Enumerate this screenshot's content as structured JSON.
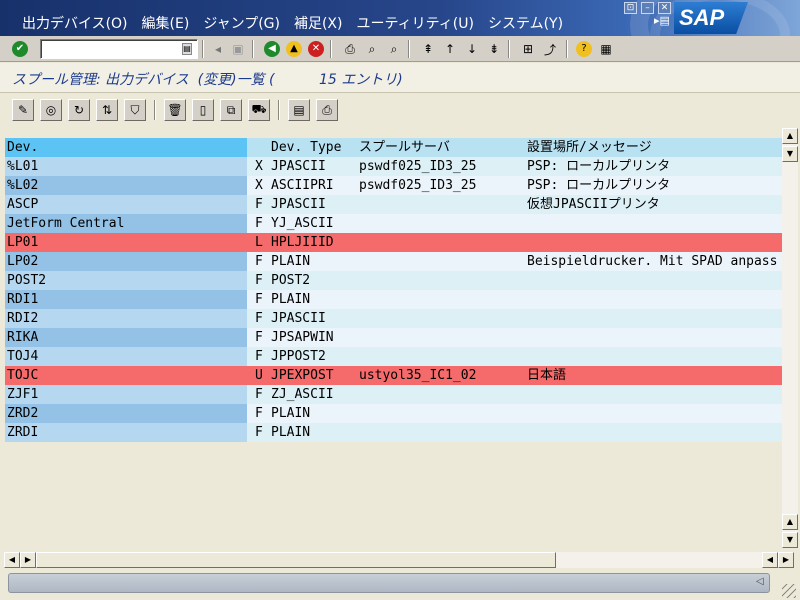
{
  "menubar": {
    "items": [
      {
        "label": "出力デバイス(O)"
      },
      {
        "label": "編集(E)"
      },
      {
        "label": "ジャンプ(G)"
      },
      {
        "label": "補足(X)"
      },
      {
        "label": "ユーティリティ(U)"
      },
      {
        "label": "システム(Y)"
      }
    ],
    "logo": "SAP"
  },
  "toolbar": {
    "command_value": "",
    "icons": [
      "enter-icon",
      "command-field",
      "back-history-icon",
      "save-icon",
      "back-icon",
      "exit-icon",
      "cancel-icon",
      "print-icon",
      "find-icon",
      "find-next-icon",
      "first-page-icon",
      "previous-page-icon",
      "next-page-icon",
      "last-page-icon",
      "new-session-icon",
      "shortcut-icon",
      "help-icon",
      "layout-menu-icon"
    ]
  },
  "title": {
    "text": "スプール管理: 出力デバイス  (変更)一覧 (          15 エントリ)"
  },
  "app_toolbar": {
    "icons": [
      "display-change-icon",
      "detail-icon",
      "refresh-icon",
      "sort-icon",
      "filter-icon",
      "delete-icon",
      "create-icon",
      "copy-icon",
      "transport-icon",
      "spool-request-icon",
      "print-list-icon"
    ]
  },
  "list": {
    "columns": {
      "dev": "Dev.",
      "access": "",
      "type": "Dev. Type",
      "server": "スプールサーバ",
      "location": "設置場所/メッセージ"
    },
    "rows": [
      {
        "dev": "%L01",
        "access": "X",
        "type": "JPASCII",
        "server": "pswdf025_ID3_25",
        "location": "PSP: ローカルプリンタ",
        "highlight": false
      },
      {
        "dev": "%L02",
        "access": "X",
        "type": "ASCIIPRI",
        "server": "pswdf025_ID3_25",
        "location": "PSP: ローカルプリンタ",
        "highlight": false
      },
      {
        "dev": "ASCP",
        "access": "F",
        "type": "JPASCII",
        "server": "",
        "location": "仮想JPASCIIプリンタ",
        "highlight": false
      },
      {
        "dev": "JetForm Central",
        "access": "F",
        "type": "YJ_ASCII",
        "server": "",
        "location": "",
        "highlight": false
      },
      {
        "dev": "LP01",
        "access": "L",
        "type": "HPLJIIID",
        "server": "",
        "location": "",
        "highlight": true
      },
      {
        "dev": "LP02",
        "access": "F",
        "type": "PLAIN",
        "server": "",
        "location": "Beispieldrucker. Mit SPAD anpass",
        "highlight": false
      },
      {
        "dev": "POST2",
        "access": "F",
        "type": "POST2",
        "server": "",
        "location": "",
        "highlight": false
      },
      {
        "dev": "RDI1",
        "access": "F",
        "type": "PLAIN",
        "server": "",
        "location": "",
        "highlight": false
      },
      {
        "dev": "RDI2",
        "access": "F",
        "type": "JPASCII",
        "server": "",
        "location": "",
        "highlight": false
      },
      {
        "dev": "RIKA",
        "access": "F",
        "type": "JPSAPWIN",
        "server": "",
        "location": "",
        "highlight": false
      },
      {
        "dev": "TOJ4",
        "access": "F",
        "type": "JPPOST2",
        "server": "",
        "location": "",
        "highlight": false
      },
      {
        "dev": "TOJC",
        "access": "U",
        "type": "JPEXPOST",
        "server": "ustyol35_IC1_02",
        "location": "日本語",
        "highlight": true
      },
      {
        "dev": "ZJF1",
        "access": "F",
        "type": "ZJ_ASCII",
        "server": "",
        "location": "",
        "highlight": false
      },
      {
        "dev": "ZRD2",
        "access": "F",
        "type": "PLAIN",
        "server": "",
        "location": "",
        "highlight": false
      },
      {
        "dev": "ZRDI",
        "access": "F",
        "type": "PLAIN",
        "server": "",
        "location": "",
        "highlight": false
      }
    ]
  },
  "colors": {
    "menubar_bg": "#1f3d7a",
    "title_text": "#1b3a8c",
    "header_dev_bg": "#5cc4f5",
    "header_bg": "#b8e2f2",
    "key_even": "#b5d7f0",
    "key_odd": "#93c2e6",
    "row_even": "#dcf0f6",
    "row_odd": "#ecf4fb",
    "highlight": "#f56a6a"
  }
}
